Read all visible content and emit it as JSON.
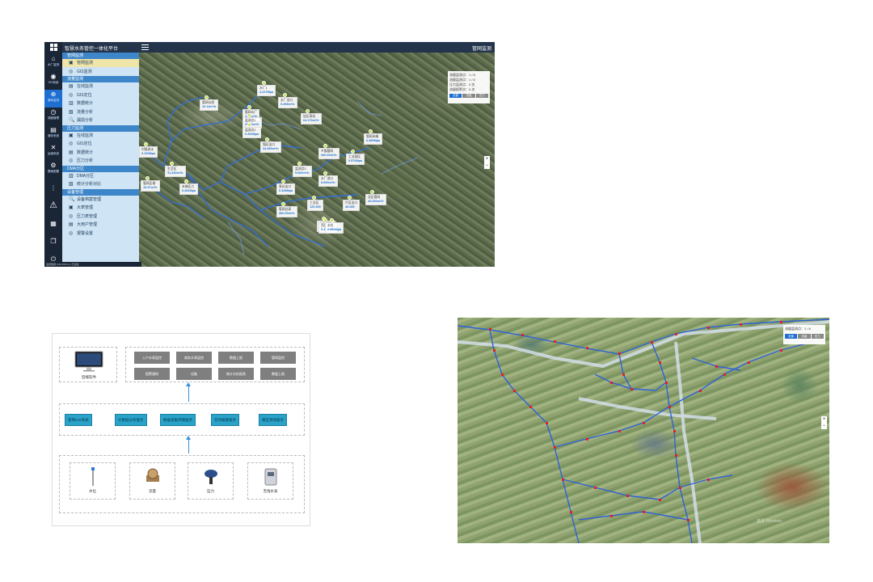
{
  "app": {
    "title": "智慧水务管控一体化平台",
    "top_right": "管网监测",
    "status": "监控数据 (123.250.0.1) 已连接",
    "sidebar_icons": [
      {
        "icon": "home-icon",
        "label": "水厂监测"
      },
      {
        "icon": "gis-icon",
        "label": "GIS系统"
      },
      {
        "icon": "network-icon",
        "label": "管网监测",
        "active": true
      },
      {
        "icon": "clock-icon",
        "label": "调度管理"
      },
      {
        "icon": "chart-icon",
        "label": "营收系统"
      },
      {
        "icon": "tools-icon",
        "label": "运维系统"
      },
      {
        "icon": "settings-icon",
        "label": "基础配置"
      }
    ],
    "menu": {
      "sections": [
        {
          "title": "管网监测",
          "items": [
            "管网监测",
            "GIS监测"
          ]
        },
        {
          "title": "流量监测",
          "items": [
            "在线监测",
            "GIS定位",
            "数据统计",
            "流量分析",
            "漏损分析"
          ]
        },
        {
          "title": "压力监测",
          "items": [
            "在线监测",
            "GIS定位",
            "数据统计",
            "压力分析"
          ]
        },
        {
          "title": "DMA分区",
          "items": [
            "DMA分区",
            "统计分析对比"
          ]
        },
        {
          "title": "设备管理",
          "items": [
            "设备档案管理",
            "大表管理",
            "压力表管理",
            "大用户管理",
            "报警设置"
          ]
        }
      ]
    },
    "map_labels": [
      {
        "name": "水厂1",
        "value": "4.227Mpa"
      },
      {
        "name": "管网水质",
        "value": "10.11m³/h"
      },
      {
        "name": "管网水厂",
        "value": "17.0m³/h"
      },
      {
        "name": "监测点1",
        "value": "20.00m³/h"
      },
      {
        "name": "监测点2",
        "value": "0.262Mpa"
      },
      {
        "name": "水厂出口",
        "value": "9.299m³/h"
      },
      {
        "name": "加压泵站",
        "value": "64.170m³/h"
      },
      {
        "name": "镇区出口",
        "value": "34.480m³/h"
      },
      {
        "name": "管网末端",
        "value": "0.480Mpa"
      },
      {
        "name": "乡镇管网",
        "value": "200.00m³/h"
      },
      {
        "name": "监测点3",
        "value": "9.000m³/h"
      },
      {
        "name": "工业园区",
        "value": "0.570Mpa"
      },
      {
        "name": "生活区",
        "value": "31.330m³/h"
      },
      {
        "name": "管网区域",
        "value": "15.47m³/h"
      },
      {
        "name": "末端压力",
        "value": "0.281Mpa"
      },
      {
        "name": "村镇进水",
        "value": "0.100Mpa"
      },
      {
        "name": "泵站出口",
        "value": "0.328Mpa"
      },
      {
        "name": "水厂进口",
        "value": "0.000m³/h"
      },
      {
        "name": "工业区",
        "value": "120.305"
      },
      {
        "name": "片区出口",
        "value": "40.080"
      },
      {
        "name": "北区管网",
        "value": "20.200m³/h"
      },
      {
        "name": "管网总表",
        "value": "300.00m³/h"
      },
      {
        "name": "南区管网",
        "value": "0.410Mpa"
      },
      {
        "name": "西区压力",
        "value": "0.480Mpa"
      },
      {
        "name": "水位",
        "value": "2.560Mpa"
      }
    ],
    "legend": {
      "rows": [
        "流量监测点：1 / 8",
        "流量监测点：1 / 8",
        "压力监测点：0 次",
        "流量报警次：0 次"
      ],
      "buttons": [
        "全部",
        "流量",
        "压力"
      ]
    }
  },
  "diagram": {
    "top_label": "后端软件",
    "top_buttons": [
      "入户水表监控",
      "商务水表监控",
      "数据上报",
      "管网监控",
      "报警通知",
      "设备",
      "统计分析报表",
      "数据上报"
    ],
    "middle_buttons": [
      "管网GIS系统",
      "大数据分析服务",
      "数据采集传输服务",
      "实时报警服务",
      "模型预测服务"
    ],
    "devices": [
      "水位",
      "流量",
      "压力",
      "无线水表"
    ]
  },
  "map2": {
    "legend": {
      "row1": "流量监测点：1 / 8",
      "buttons": [
        "全部",
        "流量",
        "压力"
      ]
    },
    "watermark": "激活 Windows"
  }
}
